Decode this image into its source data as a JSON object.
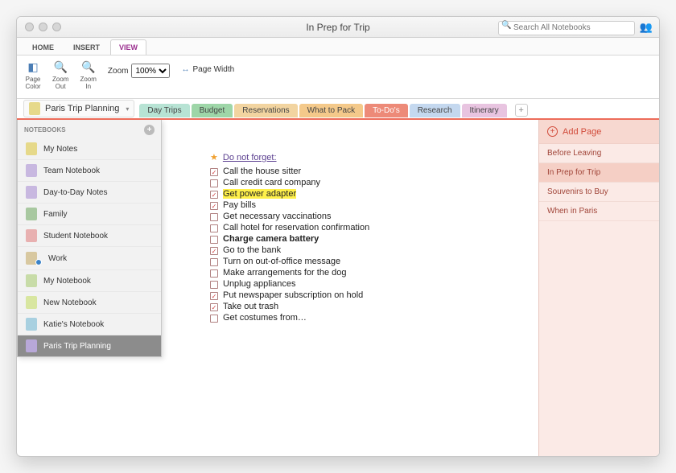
{
  "window": {
    "title": "In Prep for Trip"
  },
  "search": {
    "placeholder": "Search All Notebooks"
  },
  "menutabs": [
    {
      "label": "HOME",
      "active": false
    },
    {
      "label": "INSERT",
      "active": false
    },
    {
      "label": "VIEW",
      "active": true
    }
  ],
  "ribbon": {
    "page_color": "Page\nColor",
    "zoom_out": "Zoom\nOut",
    "zoom_in": "Zoom\nIn",
    "zoom_label": "Zoom",
    "zoom_value": "100%",
    "page_width": "Page Width"
  },
  "current_notebook": {
    "name": "Paris Trip Planning",
    "color": "#e6d98a"
  },
  "section_tabs": [
    {
      "label": "Day Trips",
      "bg": "#b7e3d4"
    },
    {
      "label": "Budget",
      "bg": "#9ed6a8"
    },
    {
      "label": "Reservations",
      "bg": "#f2d4a0"
    },
    {
      "label": "What to Pack",
      "bg": "#f4c98a"
    },
    {
      "label": "To-Do's",
      "bg": "#ed8a78",
      "active": true
    },
    {
      "label": "Research",
      "bg": "#c4d8ef"
    },
    {
      "label": "Itinerary",
      "bg": "#e8c4e0"
    }
  ],
  "notebooks_header": "NOTEBOOKS",
  "notebooks": [
    {
      "name": "My Notes",
      "color": "#e6d98a"
    },
    {
      "name": "Team Notebook",
      "color": "#c8b8e0"
    },
    {
      "name": "Day-to-Day Notes",
      "color": "#c8b8e0"
    },
    {
      "name": "Family",
      "color": "#a8c8a0"
    },
    {
      "name": "Student Notebook",
      "color": "#e8b0b0"
    },
    {
      "name": "Work",
      "color": "#d8c8a0",
      "sync": true
    },
    {
      "name": "My Notebook",
      "color": "#c8dca8"
    },
    {
      "name": "New Notebook",
      "color": "#d8e6a0"
    },
    {
      "name": "Katie's Notebook",
      "color": "#a8d0e0"
    },
    {
      "name": "Paris Trip Planning",
      "color": "#b8a8d8",
      "selected": true
    }
  ],
  "note": {
    "heading": "Do not forget:",
    "items": [
      {
        "text": "Call the house sitter",
        "checked": true
      },
      {
        "text": "Call credit card company",
        "checked": false
      },
      {
        "text": "Get power adapter",
        "checked": true,
        "highlight": true
      },
      {
        "text": "Pay bills",
        "checked": true
      },
      {
        "text": "Get necessary vaccinations",
        "checked": false
      },
      {
        "text": "Call hotel for reservation confirmation",
        "checked": false
      },
      {
        "text": "Charge camera battery",
        "checked": false,
        "bold": true
      },
      {
        "text": "Go to the bank",
        "checked": true
      },
      {
        "text": "Turn on out-of-office message",
        "checked": false
      },
      {
        "text": "Make arrangements for the dog",
        "checked": false
      },
      {
        "text": "Unplug appliances",
        "checked": false
      },
      {
        "text": "Put newspaper subscription on hold",
        "checked": true
      },
      {
        "text": "Take out trash",
        "checked": true
      },
      {
        "text": "Get costumes from…",
        "checked": false
      }
    ]
  },
  "pages": {
    "add_label": "Add Page",
    "items": [
      {
        "label": "Before Leaving"
      },
      {
        "label": "In Prep for Trip",
        "active": true
      },
      {
        "label": "Souvenirs to Buy"
      },
      {
        "label": "When in Paris"
      }
    ]
  }
}
